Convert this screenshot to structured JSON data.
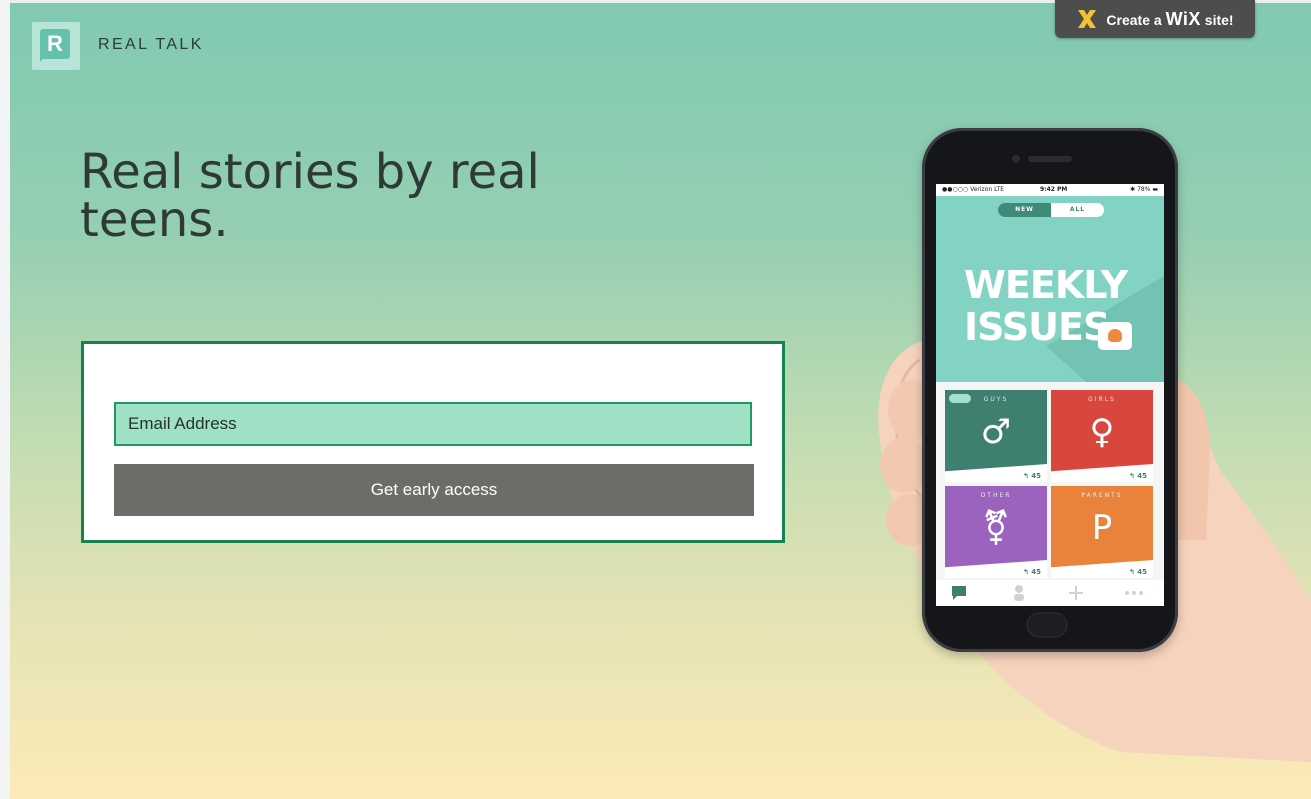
{
  "header": {
    "brand_letter": "R",
    "brand_name": "REAL TALK"
  },
  "wix_badge": {
    "prefix": "Create a",
    "word": "WiX",
    "suffix": "site!"
  },
  "hero": {
    "headline_line1": "Real stories by real",
    "headline_line2": "teens."
  },
  "form": {
    "email_placeholder": "Email Address",
    "button_label": "Get early access"
  },
  "phone": {
    "status": {
      "carrier": "●●○○○ Verizon  LTE",
      "time": "9:42 PM",
      "battery": "✱ 78% ▬"
    },
    "toggle": {
      "new": "NEW",
      "all": "ALL"
    },
    "weekly_line1": "WEEKLY",
    "weekly_line2": "ISSUES",
    "tiles": [
      {
        "category": "GUYS",
        "glyph": "♂",
        "count": "↰ 45"
      },
      {
        "category": "GIRLS",
        "glyph": "♀",
        "count": "↰ 45"
      },
      {
        "category": "OTHER",
        "glyph": "⚧",
        "count": "↰ 45"
      },
      {
        "category": "PARENTS",
        "glyph": "P",
        "count": "↰ 45"
      }
    ]
  },
  "colors": {
    "accent_green": "#17834e",
    "input_fill": "#a0e0c4",
    "button_gray": "#6e6c67",
    "tile_guys": "#3e7f70",
    "tile_girls": "#d8463d",
    "tile_other": "#9b63be",
    "tile_parents": "#e9823a"
  }
}
